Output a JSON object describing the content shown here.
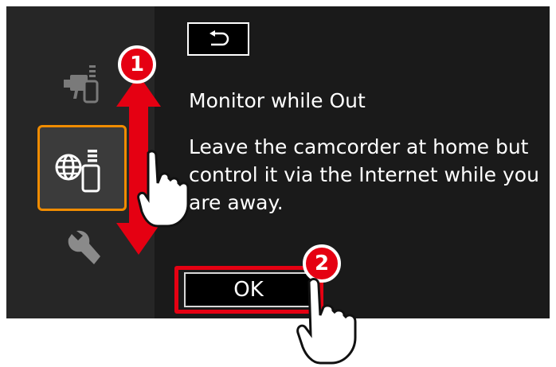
{
  "header": {
    "back_icon": "return-arrow-icon"
  },
  "sidebar": {
    "items": [
      {
        "icon": "camera-smartphone-icon",
        "selected": false
      },
      {
        "icon": "globe-smartphone-icon",
        "selected": true
      },
      {
        "icon": "wrench-icon",
        "selected": false
      }
    ]
  },
  "main": {
    "title": "Monitor while Out",
    "description": "Leave the camcorder at home but control it via the Internet while you are away.",
    "ok_label": "OK"
  },
  "callouts": {
    "step1": "1",
    "step2": "2"
  },
  "colors": {
    "screen": "#1a1a1a",
    "sidebar": "#262626",
    "highlight": "#f08c00",
    "callout": "#e50012"
  }
}
